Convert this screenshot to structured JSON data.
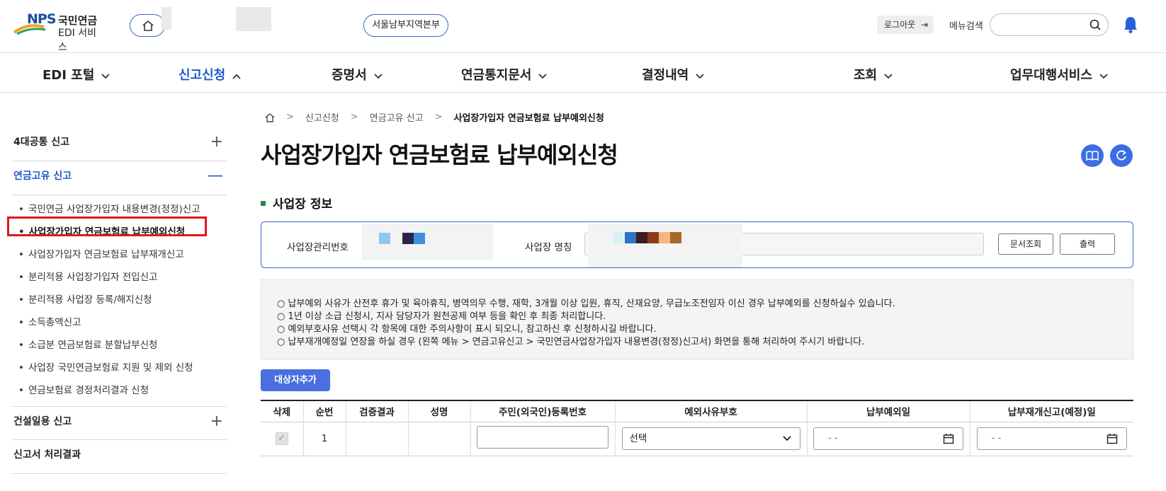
{
  "header": {
    "logo_nps": "NPS",
    "logo_kor": "국민연금",
    "logo_edi": "EDI 서비스",
    "region": "서울남부지역본부",
    "logout_label": "로그아웃",
    "menu_search_label": "메뉴검색",
    "menu_search_value": ""
  },
  "nav": {
    "items": [
      {
        "label": "EDI 포털"
      },
      {
        "label": "신고신청"
      },
      {
        "label": "증명서"
      },
      {
        "label": "연금통지문서"
      },
      {
        "label": "결정내역"
      },
      {
        "label": "조회"
      },
      {
        "label": "업무대행서비스"
      }
    ]
  },
  "sidebar": {
    "groups": [
      {
        "title": "4대공통 신고",
        "toggle": "+"
      },
      {
        "title": "연금고유 신고",
        "toggle": "—"
      },
      {
        "title": "건설일용 신고",
        "toggle": "+"
      },
      {
        "title": "신고서 처리결과",
        "toggle": ""
      }
    ],
    "sub_items": [
      {
        "label": "국민연금 사업장가입자 내용변경(정정)신고"
      },
      {
        "label": "사업장가입자 연금보험료 납부예외신청"
      },
      {
        "label": "사업장가입자 연금보험료 납부재개신고"
      },
      {
        "label": "분리적용 사업장가입자 전입신고"
      },
      {
        "label": "분리적용 사업장 등록/해지신청"
      },
      {
        "label": "소득총액신고"
      },
      {
        "label": "소급분 연금보험료 분할납부신청"
      },
      {
        "label": "사업장 국민연금보험료 지원 및 제외 신청"
      },
      {
        "label": "연금보험료 경정처리결과 신청"
      }
    ],
    "bullet": "•"
  },
  "breadcrumb": {
    "items": [
      "신고신청",
      "연금고유 신고",
      "사업장가입자 연금보험료 납부예외신청"
    ],
    "sep": ">"
  },
  "page_title": "사업장가입자 연금보험료 납부예외신청",
  "section": {
    "title": "사업장 정보",
    "biz_no_label": "사업장관리번호",
    "biz_name_label": "사업장 명칭",
    "doc_query_label": "문서조회",
    "print_label": "출력"
  },
  "notice": {
    "lines": [
      "○ 납부예외 사유가 산전후 휴가 및 육아휴직, 병역의무 수행, 재학, 3개월 이상 입원, 휴직, 산재요양, 무급노조전임자 이신 경우 납부예외를 신청하실수 있습니다.",
      "○ 1년 이상 소급 신청시, 지사 담당자가 원천공제 여부 등을 확인 후 최종 처리합니다.",
      "○ 예외부호사유 선택시 각 항목에 대한 주의사항이 표시 되오니, 참고하신 후 신청하시길 바랍니다.",
      "○ 납부재개예정일 연장을 하실 경우 (왼쪽 메뉴 > 연금고유신고 > 국민연금사업장가입자 내용변경(정정)신고서) 화면을 통해 처리하여 주시기 바랍니다."
    ]
  },
  "add_button_label": "대상자추가",
  "table": {
    "headers": [
      "삭제",
      "순번",
      "검증결과",
      "성명",
      "주민(외국인)등록번호",
      "예외사유부호",
      "납부예외일",
      "납부재개신고(예정)일"
    ],
    "rows": [
      {
        "seq": "1",
        "verify": "",
        "name": "",
        "rrn": "",
        "reason": "선택",
        "exempt_date": "- -",
        "resume_date": "- -",
        "checkmark": "✓"
      }
    ]
  },
  "colors": {
    "accent": "#2057c9",
    "button_blue": "#4a6fe0",
    "highlight_red": "#e0161e",
    "section_mark": "#1b8c45"
  }
}
